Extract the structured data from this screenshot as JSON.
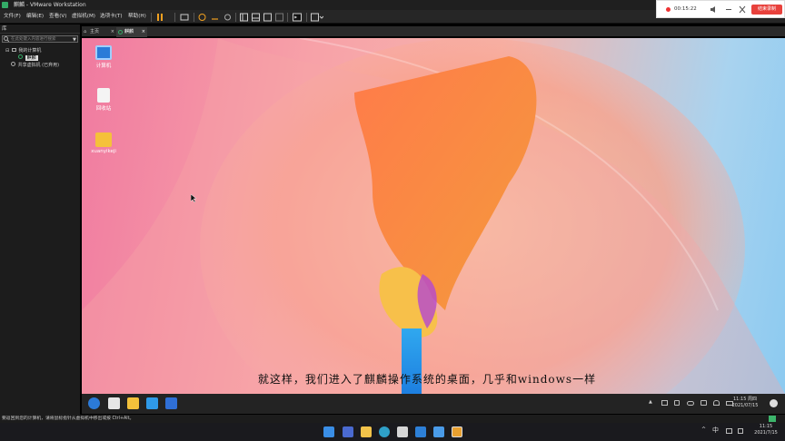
{
  "window": {
    "title": "麒麟 - VMware Workstation"
  },
  "menu": [
    "文件(F)",
    "编辑(E)",
    "查看(V)",
    "虚拟机(M)",
    "选项卡(T)",
    "帮助(H)"
  ],
  "recording": {
    "time": "00:15:22",
    "stop_label": "结束录制"
  },
  "library": {
    "header": "库",
    "search_placeholder": "在此处键入内容进行搜索",
    "tree": {
      "my_computer": "我的计算机",
      "vm": "麒麟",
      "shared": "共享虚拟机 (已弃用)"
    }
  },
  "tabs": [
    {
      "label": "主页"
    },
    {
      "label": "麒麟"
    }
  ],
  "desktop": {
    "icons": [
      {
        "label": "计算机"
      },
      {
        "label": "回收站"
      },
      {
        "label": "xuanyikeji"
      }
    ],
    "subtitle": "就这样，我们进入了麒麟操作系统的桌面，几乎和windows一样"
  },
  "guest_clock": {
    "time": "11:15 周四",
    "date": "2021/07/15"
  },
  "status": {
    "text": "要返回到您的计算机，请将鼠标指针从虚拟机中移出或按 Ctrl+Alt。"
  },
  "host_clock": {
    "time": "11:15",
    "date": "2021/7/15"
  },
  "host_tray": {
    "ime": "中"
  },
  "colors": {
    "accent_red": "#e8413c",
    "desktop_pink": "#f07aa0",
    "desktop_blue": "#8ccaf0"
  }
}
